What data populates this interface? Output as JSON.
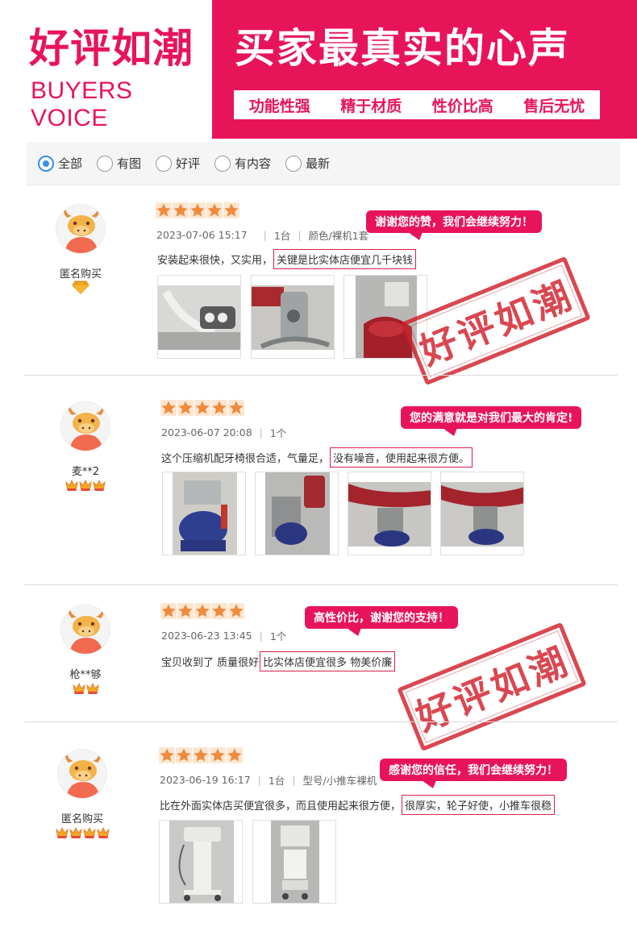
{
  "header": {
    "title": "好评如潮",
    "subtitle": "BUYERS VOICE",
    "slogan": "买家最真实的心声",
    "tags": [
      "功能性强",
      "精于材质",
      "性价比高",
      "售后无忧"
    ]
  },
  "filters": [
    {
      "label": "全部",
      "selected": true
    },
    {
      "label": "有图",
      "selected": false
    },
    {
      "label": "好评",
      "selected": false
    },
    {
      "label": "有内容",
      "selected": false
    },
    {
      "label": "最新",
      "selected": false
    }
  ],
  "stamp_text": "好评如潮",
  "colors": {
    "brand": "#e8145a",
    "star": "#f08a3c",
    "stamp": "#d21f2a",
    "radio_selected": "#3a8ee6"
  },
  "reviews": [
    {
      "user": "匿名购买",
      "badge": "diamond",
      "badge_count": 1,
      "stars": 5,
      "date": "2023-07-06 15:17",
      "quantity": "1台",
      "spec": "颜色/裸机1套",
      "text": "安装起来很快，又实用，",
      "highlight": "关键是比实体店便宜几千块钱",
      "reply": "谢谢您的赞，我们会继续努力！",
      "photos": [
        "dental-lamp",
        "dental-chair-column",
        "dental-chair-red"
      ],
      "stamp": true
    },
    {
      "user": "麦**2",
      "badge": "crown",
      "badge_count": 3,
      "stars": 5,
      "date": "2023-06-07 20:08",
      "quantity": "1个",
      "spec": "",
      "text": "这个压缩机配牙椅很合适，气量足，",
      "highlight": "没有噪音，使用起来很方便。",
      "reply": "您的满意就是对我们最大的肯定!",
      "photos": [
        "air-compressor",
        "chair-unit",
        "chair-attachment",
        "chair-attachment-2"
      ],
      "stamp": false
    },
    {
      "user": "枪**够",
      "badge": "crown",
      "badge_count": 2,
      "stars": 5,
      "date": "2023-06-23 13:45",
      "quantity": "1个",
      "spec": "",
      "text": "宝贝收到了 质量很好",
      "highlight": "比实体店便宜很多 物美价廉",
      "reply": "高性价比，谢谢您的支持！",
      "photos": [],
      "stamp": true
    },
    {
      "user": "匿名购买",
      "badge": "crown",
      "badge_count": 4,
      "stars": 5,
      "date": "2023-06-19 16:17",
      "quantity": "1台",
      "spec": "型号/小推车裸机",
      "text": "比在外面实体店买便宜很多，而且使用起来很方便，",
      "highlight": "很厚实，轮子好使，小推车很稳",
      "reply": "感谢您的信任，我们会继续努力！",
      "photos": [
        "mobile-cart",
        "mobile-cart-2"
      ],
      "stamp": false
    }
  ]
}
